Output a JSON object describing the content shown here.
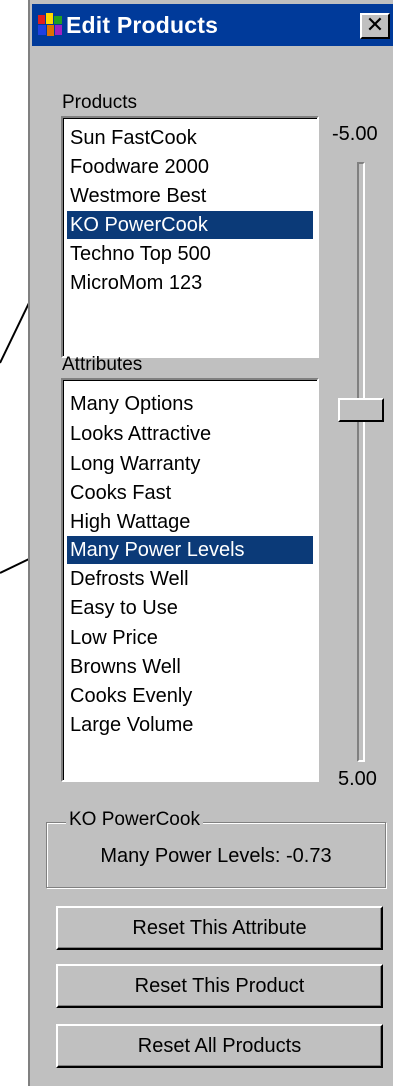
{
  "window": {
    "title": "Edit Products",
    "close_label": "✕",
    "icon": "app-icon"
  },
  "products": {
    "label": "Products",
    "items": [
      "Sun FastCook",
      "Foodware 2000",
      "Westmore Best",
      "KO PowerCook",
      "Techno Top 500",
      "MicroMom 123"
    ],
    "selected": "KO PowerCook"
  },
  "attributes": {
    "label": "Attributes",
    "items": [
      "Many Options",
      "Looks Attractive",
      "Long Warranty",
      "Cooks Fast",
      "High Wattage",
      "Many Power Levels",
      "Defrosts Well",
      "Easy to Use",
      "Low Price",
      "Browns Well",
      "Cooks Evenly",
      "Large Volume"
    ],
    "selected": "Many Power Levels"
  },
  "slider": {
    "min_label": "-5.00",
    "max_label": "5.00",
    "min": -5.0,
    "max": 5.0,
    "value": -0.73
  },
  "group": {
    "legend": "KO PowerCook",
    "value_text": "Many Power Levels: -0.73"
  },
  "buttons": {
    "reset_attribute": "Reset This Attribute",
    "reset_product": "Reset This Product",
    "reset_all": "Reset All Products"
  },
  "colors": {
    "titlebar": "#003a9a",
    "selection": "#0b3a78",
    "face": "#c0c0c0"
  }
}
